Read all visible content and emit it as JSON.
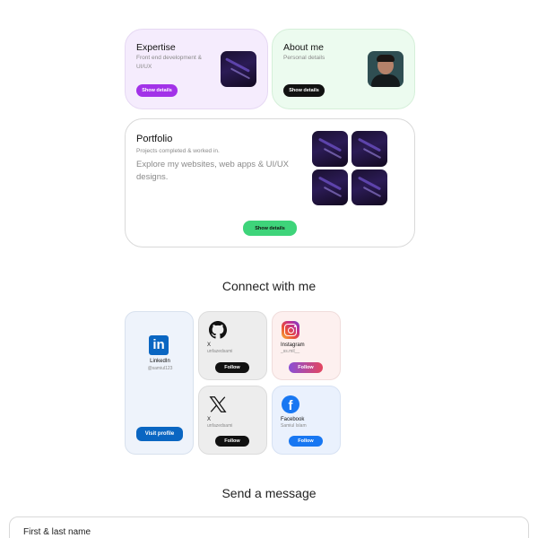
{
  "expertise": {
    "title": "Expertise",
    "subtitle": "Front end development & UI/UX",
    "button": "Show details",
    "bg": "#f5ecfd",
    "button_color": "#a232e8"
  },
  "about": {
    "title": "About me",
    "subtitle": "Personal details",
    "button": "Show details",
    "bg": "#ecfbef"
  },
  "portfolio": {
    "title": "Portfolio",
    "subtitle": "Projects completed & worked in.",
    "description": "Explore my websites, web apps & UI/UX designs.",
    "button": "Show details",
    "button_color": "#3ed47a"
  },
  "connect": {
    "heading": "Connect with me",
    "linkedin": {
      "name": "LinkedIn",
      "handle": "@samiul123",
      "button": "Visit profile",
      "icon": "linkedin-icon",
      "color": "#0a66c2"
    },
    "github": {
      "name": "X",
      "handle": "unfazedsami",
      "button": "Follow",
      "icon": "github-icon"
    },
    "instagram": {
      "name": "Instagram",
      "handle": "_ss.mil__",
      "button": "Follow",
      "icon": "instagram-icon"
    },
    "x": {
      "name": "X",
      "handle": "unfazedsami",
      "button": "Follow",
      "icon": "x-icon"
    },
    "facebook": {
      "name": "Facebook",
      "handle": "Samiul Islam",
      "button": "Follow",
      "icon": "facebook-icon",
      "color": "#1877f2"
    }
  },
  "message": {
    "heading": "Send a message",
    "placeholder": "First & last name"
  }
}
